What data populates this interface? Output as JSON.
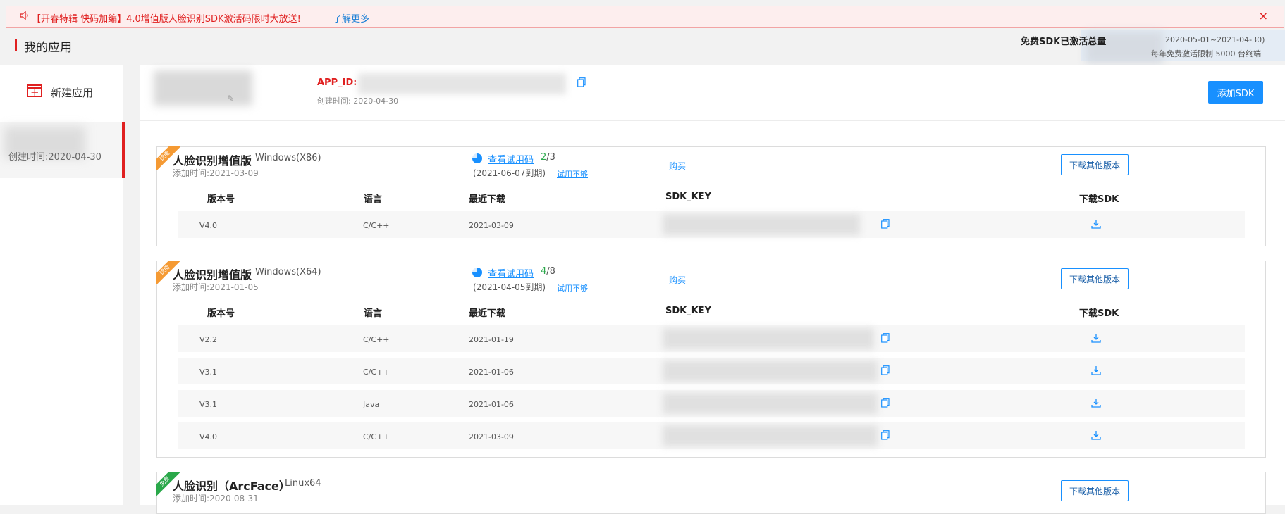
{
  "banner": {
    "text": "【开春特辑 快码加编】4.0增值版人脸识别SDK激活码限时大放送!",
    "link": "了解更多",
    "close": "×"
  },
  "page": {
    "title": "我的应用"
  },
  "stats": {
    "label": "免费SDK已激活总量",
    "date_range": "2020-05-01~2021-04-30)",
    "limit": "每年免费激活限制 5000 台终端"
  },
  "sidebar": {
    "new_app": "新建应用",
    "app_created": "创建时间:2020-04-30"
  },
  "app": {
    "appid_label": "APP_ID:",
    "created": "创建时间: 2020-04-30",
    "add_sdk": "添加SDK"
  },
  "table_headers": {
    "version": "版本号",
    "language": "语言",
    "last_download": "最近下载",
    "sdk_key": "SDK_KEY",
    "download": "下载SDK"
  },
  "cards": [
    {
      "badge": "试用",
      "title": "人脸识别增值版",
      "platform": "Windows(X86)",
      "added": "添加时间:2021-03-09",
      "trial_link": "查看试用码",
      "trial_used": "2",
      "trial_total": "/3",
      "trial_expire": "(2021-06-07到期)",
      "trial_more": "试用不够",
      "buy": "购买",
      "other_versions": "下载其他版本",
      "rows": [
        {
          "version": "V4.0",
          "language": "C/C++",
          "last_download": "2021-03-09"
        }
      ]
    },
    {
      "badge": "试用",
      "title": "人脸识别增值版",
      "platform": "Windows(X64)",
      "added": "添加时间:2021-01-05",
      "trial_link": "查看试用码",
      "trial_used": "4",
      "trial_total": "/8",
      "trial_expire": "(2021-04-05到期)",
      "trial_more": "试用不够",
      "buy": "购买",
      "other_versions": "下载其他版本",
      "rows": [
        {
          "version": "V2.2",
          "language": "C/C++",
          "last_download": "2021-01-19"
        },
        {
          "version": "V3.1",
          "language": "C/C++",
          "last_download": "2021-01-06"
        },
        {
          "version": "V3.1",
          "language": "Java",
          "last_download": "2021-01-06"
        },
        {
          "version": "V4.0",
          "language": "C/C++",
          "last_download": "2021-03-09"
        }
      ]
    },
    {
      "badge": "免费",
      "title": "人脸识别（ArcFace）",
      "platform": "Linux64",
      "added": "添加时间:2020-08-31",
      "other_versions": "下载其他版本"
    }
  ],
  "colors": {
    "accent": "#1890ff",
    "danger": "#e02020",
    "trial": "#f59a33",
    "free": "#2aa84a"
  },
  "icons": [
    "speaker-icon",
    "close-icon",
    "add-app-icon",
    "edit-icon",
    "copy-icon",
    "pie-icon",
    "download-icon"
  ]
}
